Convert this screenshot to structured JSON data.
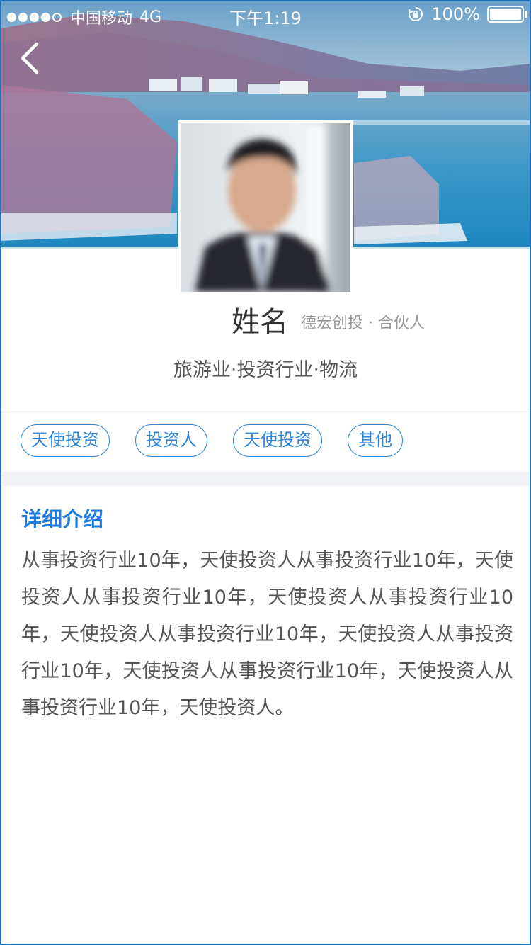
{
  "status_bar": {
    "carrier": "中国移动",
    "network": "4G",
    "time": "下午1:19",
    "battery": "100%"
  },
  "profile": {
    "name": "姓名",
    "org": "德宏创投 · 合伙人",
    "industries": "旅游业·投资行业·物流"
  },
  "tags": [
    "天使投资",
    "投资人",
    "天使投资",
    "其他"
  ],
  "detail": {
    "title": "详细介绍",
    "body": "从事投资行业10年，天使投资人从事投资行业10年，天使投资人从事投资行业10年，天使投资人从事投资行业10年，天使投资人从事投资行业10年，天使投资人从事投资行业10年，天使投资人从事投资行业10年，天使投资人从事投资行业10年，天使投资人。"
  },
  "colors": {
    "accent": "#2f86d9",
    "title_blue": "#1e7ee0",
    "band": "#f2f3f7"
  },
  "icons": {
    "back": "chevron-left-icon",
    "rotation_lock": "rotation-lock-icon",
    "battery": "battery-icon",
    "signal": "signal-icon"
  }
}
